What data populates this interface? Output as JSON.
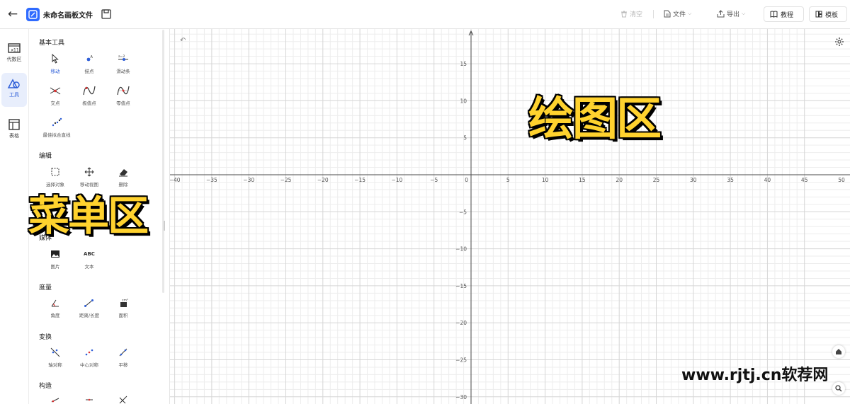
{
  "header": {
    "title": "未命名画板文件",
    "clear_label": "清空",
    "file_label": "文件",
    "export_label": "导出",
    "tutorial_label": "教程",
    "template_label": "模板"
  },
  "rail": {
    "items": [
      {
        "label": "代数区"
      },
      {
        "label": "工具"
      },
      {
        "label": "表格"
      }
    ]
  },
  "tools": {
    "sections": [
      {
        "title": "基本工具",
        "items": [
          "移动",
          "描点",
          "滑动条",
          "交点",
          "极值点",
          "零值点",
          "最佳拟合直线"
        ]
      },
      {
        "title": "编辑",
        "items": [
          "选择对象",
          "移动视图",
          "删除"
        ]
      },
      {
        "title": "媒体",
        "items": [
          "图片",
          "文本"
        ]
      },
      {
        "title": "度量",
        "items": [
          "角度",
          "距离/长度",
          "面积"
        ]
      },
      {
        "title": "变换",
        "items": [
          "轴对称",
          "中心对称",
          "平移"
        ]
      },
      {
        "title": "构造",
        "items": []
      }
    ],
    "text_tool_glyph": "ABC",
    "selected": "移动"
  },
  "graph": {
    "x_ticks": [
      "−40",
      "−35",
      "−30",
      "−25",
      "−20",
      "−15",
      "−10",
      "−5",
      "0",
      "5",
      "10",
      "15",
      "20",
      "25",
      "30",
      "35",
      "40",
      "45",
      "50"
    ],
    "y_ticks_pos": [
      "15",
      "10",
      "5"
    ],
    "y_ticks_neg": [
      "−5",
      "−10",
      "−15",
      "−20",
      "−25",
      "−30"
    ]
  },
  "overlays": {
    "menu_area": "菜单区",
    "drawing_area": "绘图区",
    "watermark": "www.rjtj.cn软荐网"
  },
  "colors": {
    "accent": "#2f6bff",
    "overlay_text": "#ffd22e",
    "grid_minor": "#ededed",
    "grid_major": "#d6d6d6",
    "axis": "#4a4a4a"
  }
}
